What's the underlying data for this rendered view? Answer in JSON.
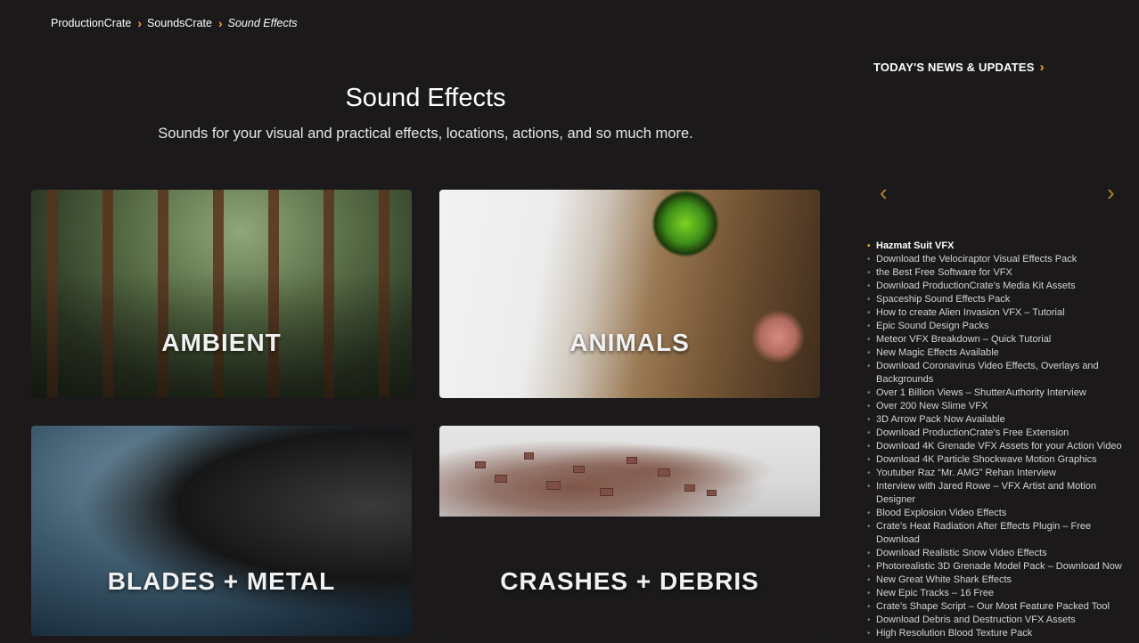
{
  "breadcrumb": {
    "items": [
      "ProductionCrate",
      "SoundsCrate"
    ],
    "current": "Sound Effects"
  },
  "header": {
    "title": "Sound Effects",
    "subtitle": "Sounds for your visual and practical effects, locations, actions, and so much more."
  },
  "categories": [
    {
      "label": "AMBIENT"
    },
    {
      "label": "ANIMALS"
    },
    {
      "label": "BLADES + METAL"
    },
    {
      "label": "CRASHES + DEBRIS"
    }
  ],
  "news": {
    "heading": "TODAY'S NEWS & UPDATES",
    "items": [
      "Hazmat Suit VFX",
      "Download the Velociraptor Visual Effects Pack",
      "the Best Free Software for VFX",
      "Download ProductionCrate’s Media Kit Assets",
      "Spaceship Sound Effects Pack",
      "How to create Alien Invasion VFX – Tutorial",
      "Epic Sound Design Packs",
      "Meteor VFX Breakdown – Quick Tutorial",
      "New Magic Effects Available",
      "Download Coronavirus Video Effects, Overlays and Backgrounds",
      "Over 1 Billion Views – ShutterAuthority Interview",
      "Over 200 New Slime VFX",
      "3D Arrow Pack Now Available",
      "Download ProductionCrate’s Free Extension",
      "Download 4K Grenade VFX Assets for your Action Video",
      "Download 4K Particle Shockwave Motion Graphics",
      "Youtuber Raz “Mr. AMG” Rehan Interview",
      "Interview with Jared Rowe – VFX Artist and Motion Designer",
      "Blood Explosion Video Effects",
      "Crate’s Heat Radiation After Effects Plugin – Free Download",
      "Download Realistic Snow Video Effects",
      "Photorealistic 3D Grenade Model Pack – Download Now",
      "New Great White Shark Effects",
      "New Epic Tracks – 16 Free",
      "Crate’s Shape Script – Our Most Feature Packed Tool",
      "Download Debris and Destruction VFX Assets",
      "High Resolution Blood Texture Pack"
    ]
  },
  "icons": {
    "breadcrumb_separator": "chevron-right-icon",
    "carousel_prev": "chevron-left-icon",
    "carousel_next": "chevron-right-icon"
  },
  "colors": {
    "accent": "#f5a623",
    "background": "#1b191a"
  }
}
